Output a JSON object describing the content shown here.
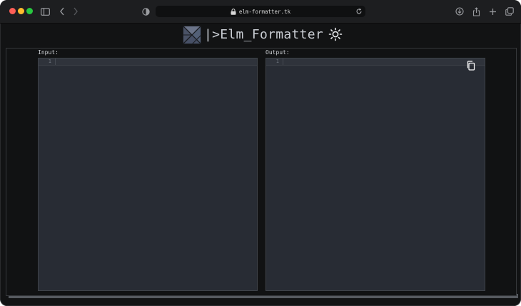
{
  "browser": {
    "url": "elm-formatter.tk"
  },
  "header": {
    "title": "|>Elm_Formatter"
  },
  "input_pane": {
    "label": "Input:",
    "line_number": "1",
    "value": ""
  },
  "output_pane": {
    "label": "Output:",
    "line_number": "1",
    "value": ""
  },
  "icons": {
    "sidebar": "sidebar-icon",
    "back": "chevron-left-icon",
    "forward": "chevron-right-icon",
    "privacy": "shield-icon",
    "lock": "lock-icon",
    "reload": "reload-icon",
    "download": "download-icon",
    "share": "share-icon",
    "new_tab": "plus-icon",
    "tabs": "tabs-icon",
    "theme": "sun-icon",
    "copy": "copy-icon",
    "logo": "elm-logo"
  },
  "colors": {
    "background": "#121314",
    "editor_bg": "#282c34",
    "text": "#c9cdd3",
    "close": "#fe5f57",
    "minimize": "#febc2e",
    "maximize": "#28c840"
  }
}
